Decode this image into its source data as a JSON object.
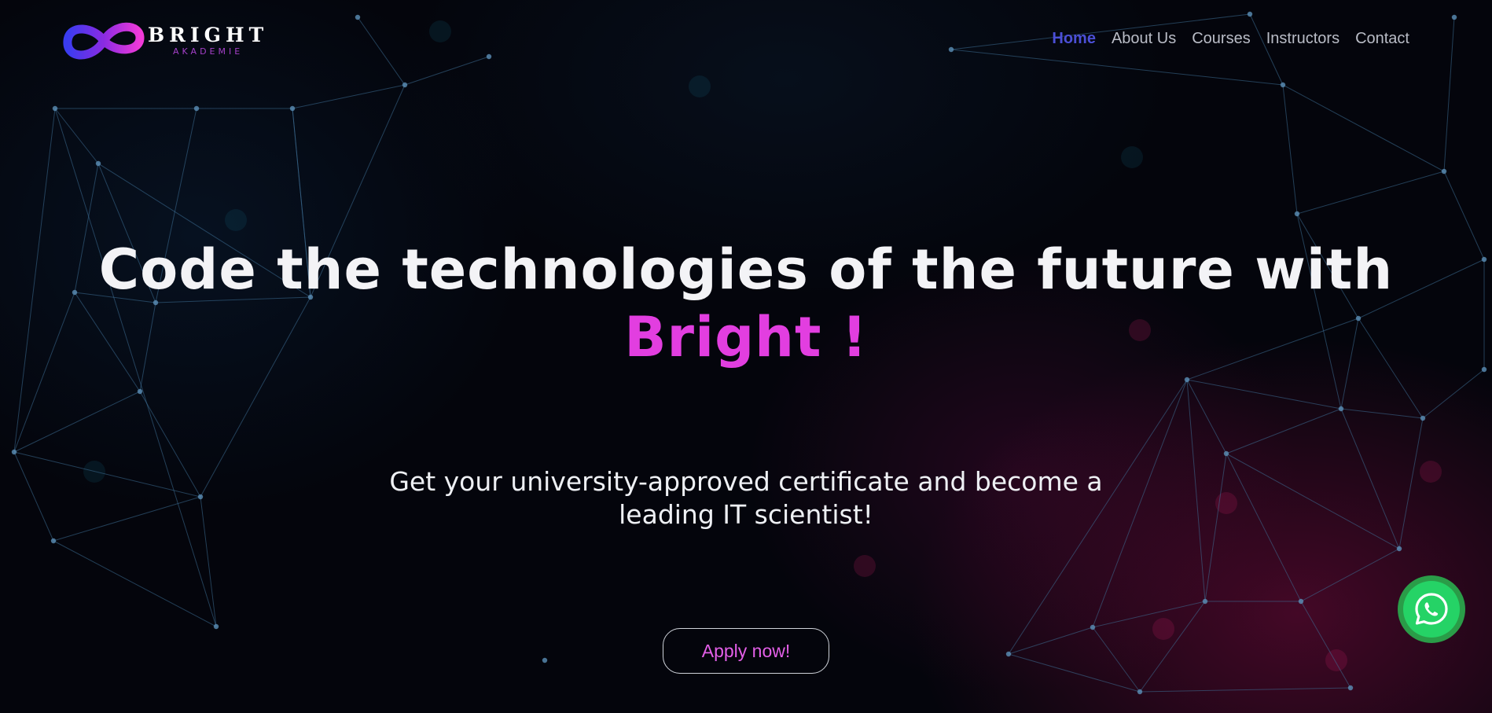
{
  "brand": {
    "name": "BRIGHT",
    "sub": "AKADEMIE",
    "logo_icon": "infinity-logo-icon"
  },
  "nav": {
    "items": [
      {
        "label": "Home",
        "active": true
      },
      {
        "label": "About Us",
        "active": false
      },
      {
        "label": "Courses",
        "active": false
      },
      {
        "label": "Instructors",
        "active": false
      },
      {
        "label": "Contact",
        "active": false
      }
    ]
  },
  "hero": {
    "title_line1": "Code the technologies of the future with",
    "title_brand": "Bright",
    "title_exclaim": "!",
    "subtitle_line1": "Get your university-approved certificate and become a",
    "subtitle_line2": "leading IT scientist!",
    "cta_label": "Apply now!"
  },
  "floating": {
    "whatsapp_icon": "whatsapp-icon"
  },
  "colors": {
    "background": "#04050c",
    "accent_pink": "#e23ee0",
    "nav_active": "#4b4fd6",
    "whatsapp_green": "#25d366"
  }
}
